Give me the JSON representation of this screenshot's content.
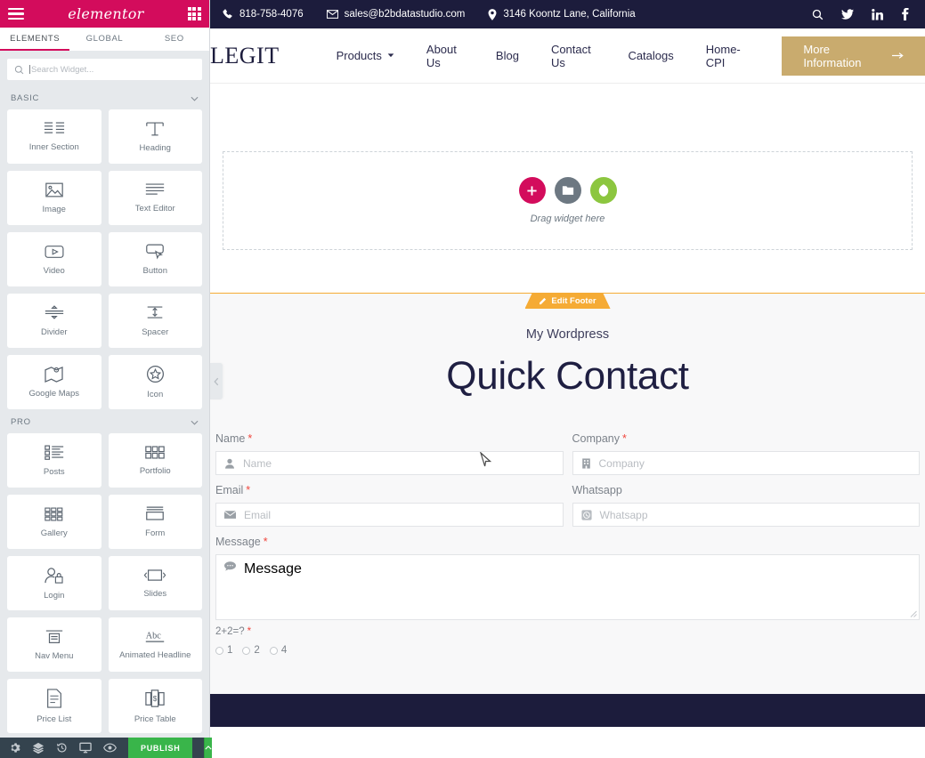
{
  "panel": {
    "logo": "elementor",
    "menu_icon": "hamburger-icon",
    "grid_icon": "apps-grid-icon",
    "tabs": [
      {
        "label": "ELEMENTS",
        "active": true
      },
      {
        "label": "GLOBAL",
        "active": false
      },
      {
        "label": "SEO",
        "active": false
      }
    ],
    "search": {
      "placeholder": "Search Widget..."
    },
    "categories": [
      {
        "label": "BASIC"
      },
      {
        "label": "PRO"
      }
    ],
    "basic_widgets": [
      {
        "label": "Inner Section",
        "icon": "inner-section-icon"
      },
      {
        "label": "Heading",
        "icon": "heading-icon"
      },
      {
        "label": "Image",
        "icon": "image-icon"
      },
      {
        "label": "Text Editor",
        "icon": "text-editor-icon"
      },
      {
        "label": "Video",
        "icon": "video-icon"
      },
      {
        "label": "Button",
        "icon": "button-icon"
      },
      {
        "label": "Divider",
        "icon": "divider-icon"
      },
      {
        "label": "Spacer",
        "icon": "spacer-icon"
      },
      {
        "label": "Google Maps",
        "icon": "google-maps-icon"
      },
      {
        "label": "Icon",
        "icon": "star-icon"
      }
    ],
    "pro_widgets": [
      {
        "label": "Posts",
        "icon": "posts-icon"
      },
      {
        "label": "Portfolio",
        "icon": "portfolio-icon"
      },
      {
        "label": "Gallery",
        "icon": "gallery-icon"
      },
      {
        "label": "Form",
        "icon": "form-icon"
      },
      {
        "label": "Login",
        "icon": "login-icon"
      },
      {
        "label": "Slides",
        "icon": "slides-icon"
      },
      {
        "label": "Nav Menu",
        "icon": "nav-menu-icon"
      },
      {
        "label": "Animated Headline",
        "icon": "animated-headline-icon"
      },
      {
        "label": "Price List",
        "icon": "price-list-icon"
      },
      {
        "label": "Price Table",
        "icon": "price-table-icon"
      }
    ],
    "footer": {
      "settings_icon": "gear-icon",
      "navigator_icon": "layers-icon",
      "history_icon": "history-icon",
      "responsive_icon": "desktop-icon",
      "preview_icon": "eye-icon",
      "publish_label": "PUBLISH",
      "publish_arrow_icon": "chevron-up-icon"
    }
  },
  "colors": {
    "elementor_pink": "#d30c5c",
    "publish_green": "#39b54a",
    "edit_tab_orange": "#f5ab35",
    "site_navy": "#1c1c3c",
    "cta_gold": "#c9ab6e",
    "required_red": "#f0473e"
  },
  "canvas": {
    "collapse_handle_icon": "chevron-left-icon",
    "topbar": {
      "phone": "818-758-4076",
      "phone_icon": "phone-icon",
      "email": "sales@b2bdatastudio.com",
      "email_icon": "envelope-icon",
      "address": "3146 Koontz Lane, California",
      "address_icon": "map-pin-icon",
      "social": [
        {
          "name": "search-icon"
        },
        {
          "name": "twitter-icon"
        },
        {
          "name": "linkedin-icon"
        },
        {
          "name": "facebook-icon"
        }
      ]
    },
    "navbar": {
      "brand": "LEGIT",
      "links": [
        {
          "label": "Products",
          "has_dropdown": true
        },
        {
          "label": "About Us",
          "has_dropdown": false
        },
        {
          "label": "Blog",
          "has_dropdown": false
        },
        {
          "label": "Contact Us",
          "has_dropdown": false
        },
        {
          "label": "Catalogs",
          "has_dropdown": false
        },
        {
          "label": "Home-CPI",
          "has_dropdown": false
        }
      ],
      "cta_label": "More Information",
      "cta_icon": "arrow-right-icon"
    },
    "dropzone": {
      "label": "Drag widget here",
      "buttons": [
        {
          "name": "add-section-button",
          "icon": "plus-icon"
        },
        {
          "name": "add-template-button",
          "icon": "folder-icon"
        },
        {
          "name": "add-leaf-button",
          "icon": "leaf-icon"
        }
      ]
    },
    "edit_footer_tab": {
      "label": "Edit Footer",
      "icon": "pencil-icon"
    },
    "footer_section": {
      "subtitle": "My Wordpress",
      "title": "Quick Contact",
      "fields": [
        {
          "label": "Name",
          "required": true,
          "placeholder": "Name",
          "icon": "user-icon",
          "type": "text"
        },
        {
          "label": "Company",
          "required": true,
          "placeholder": "Company",
          "icon": "building-icon",
          "type": "text"
        },
        {
          "label": "Email",
          "required": true,
          "placeholder": "Email",
          "icon": "envelope-icon",
          "type": "text"
        },
        {
          "label": "Whatsapp",
          "required": false,
          "placeholder": "Whatsapp",
          "icon": "whatsapp-icon",
          "type": "text"
        },
        {
          "label": "Message",
          "required": true,
          "placeholder": "Message",
          "icon": "chat-bubble-icon",
          "type": "textarea"
        }
      ],
      "captcha": {
        "question": "2+2=?",
        "required": true,
        "options": [
          {
            "label": "1",
            "selected": false
          },
          {
            "label": "2",
            "selected": false
          },
          {
            "label": "4",
            "selected": false
          }
        ]
      }
    }
  }
}
